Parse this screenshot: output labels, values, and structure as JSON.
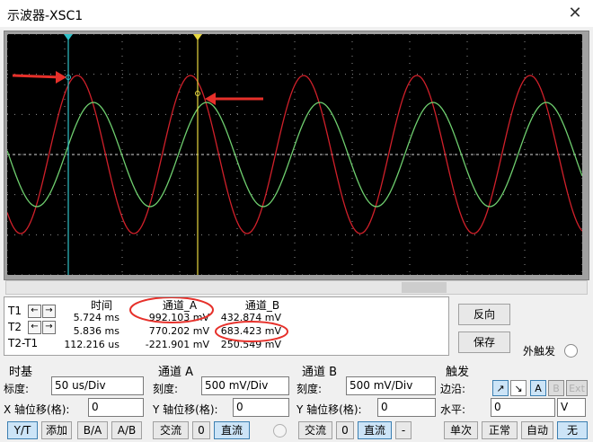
{
  "window": {
    "title": "示波器-XSC1",
    "close_glyph": "✕"
  },
  "scope": {
    "background": "#000000",
    "grid_color": "#909090",
    "channel_a_color": "#d0202a",
    "channel_b_color": "#6fcf6f",
    "cursor1_color": "#2fc0c8",
    "cursor2_color": "#e8d840",
    "annotation_color": "#e6302a"
  },
  "measurements": {
    "headers": {
      "time": "时间",
      "channel_a": "通道_A",
      "channel_b": "通道_B"
    },
    "rows": [
      {
        "label": "T1",
        "time": "5.724 ms",
        "a": "992.103 mV",
        "b": "432.874 mV"
      },
      {
        "label": "T2",
        "time": "5.836 ms",
        "a": "770.202 mV",
        "b": "683.423 mV"
      },
      {
        "label": "T2-T1",
        "time": "112.216 us",
        "a": "-221.901 mV",
        "b": "250.549 mV"
      }
    ]
  },
  "buttons": {
    "reverse": "反向",
    "save": "保存",
    "ext_trigger": "外触发"
  },
  "timebase": {
    "title": "时基",
    "scale_label": "标度:",
    "scale_value": "50 us/Div",
    "xpos_label": "X 轴位移(格):",
    "xpos_value": "0",
    "modes": [
      "Y/T",
      "添加",
      "B/A",
      "A/B"
    ]
  },
  "channel_a": {
    "title": "通道 A",
    "scale_label": "刻度:",
    "scale_value": "500 mV/Div",
    "ypos_label": "Y 轴位移(格):",
    "ypos_value": "0",
    "coupling": [
      "交流",
      "0",
      "直流"
    ]
  },
  "channel_b": {
    "title": "通道 B",
    "scale_label": "刻度:",
    "scale_value": "500 mV/Div",
    "ypos_label": "Y 轴位移(格):",
    "ypos_value": "0",
    "coupling": [
      "交流",
      "0",
      "直流",
      "-"
    ]
  },
  "trigger": {
    "title": "触发",
    "edge_label": "边沿:",
    "edge_rise": "↗",
    "edge_fall": "↘",
    "sources": [
      "A",
      "B",
      "Ext"
    ],
    "level_label": "水平:",
    "level_value": "0",
    "level_unit": "V",
    "modes": [
      "单次",
      "正常",
      "自动",
      "无"
    ]
  }
}
